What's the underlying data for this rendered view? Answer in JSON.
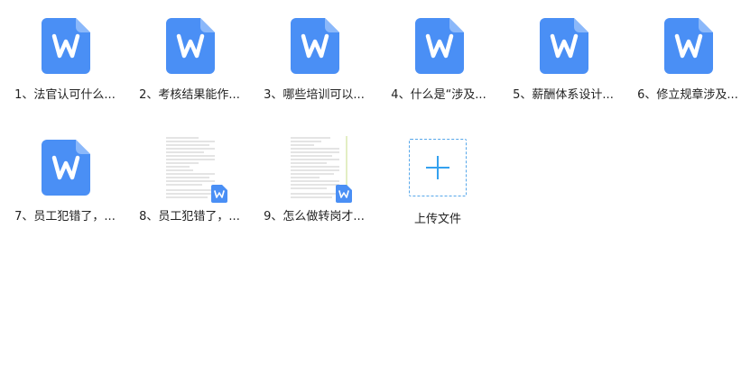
{
  "files": [
    {
      "name": "1、法官认可什么...",
      "thumb": "word-icon"
    },
    {
      "name": "2、考核结果能作...",
      "thumb": "word-icon"
    },
    {
      "name": "3、哪些培训可以...",
      "thumb": "word-icon"
    },
    {
      "name": "4、什么是“涉及...",
      "thumb": "word-icon"
    },
    {
      "name": "5、薪酬体系设计...",
      "thumb": "word-icon"
    },
    {
      "name": "6、修立规章涉及...",
      "thumb": "word-icon"
    },
    {
      "name": "7、员工犯错了，...",
      "thumb": "word-icon"
    },
    {
      "name": "8、员工犯错了，...",
      "thumb": "document-preview"
    },
    {
      "name": "9、怎么做转岗才...",
      "thumb": "document-preview"
    }
  ],
  "upload": {
    "label": "上传文件",
    "icon": "plus-icon"
  },
  "colors": {
    "word_blue": "#4a8ff5",
    "word_blue_light": "#74a8f8",
    "upload_accent": "#34a1ef"
  }
}
